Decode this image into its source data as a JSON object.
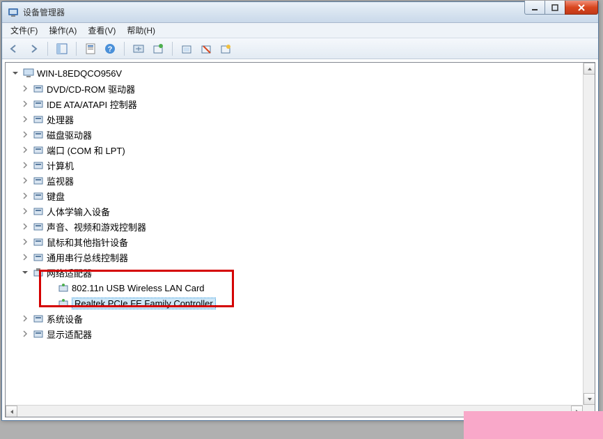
{
  "window": {
    "title": "设备管理器"
  },
  "menu": {
    "file": "文件(F)",
    "action": "操作(A)",
    "view": "查看(V)",
    "help": "帮助(H)"
  },
  "tree": {
    "root": "WIN-L8EDQCO956V",
    "items": [
      {
        "label": "DVD/CD-ROM 驱动器",
        "icon": "disc"
      },
      {
        "label": "IDE ATA/ATAPI 控制器",
        "icon": "ide"
      },
      {
        "label": "处理器",
        "icon": "cpu"
      },
      {
        "label": "磁盘驱动器",
        "icon": "disk"
      },
      {
        "label": "端口 (COM 和 LPT)",
        "icon": "port"
      },
      {
        "label": "计算机",
        "icon": "computer"
      },
      {
        "label": "监视器",
        "icon": "monitor"
      },
      {
        "label": "键盘",
        "icon": "keyboard"
      },
      {
        "label": "人体学输入设备",
        "icon": "hid"
      },
      {
        "label": "声音、视频和游戏控制器",
        "icon": "sound"
      },
      {
        "label": "鼠标和其他指针设备",
        "icon": "mouse"
      },
      {
        "label": "通用串行总线控制器",
        "icon": "usb"
      }
    ],
    "network": {
      "label": "网络适配器",
      "children": [
        "802.11n USB Wireless LAN Card",
        "Realtek PCIe FE Family Controller"
      ]
    },
    "after": [
      {
        "label": "系统设备",
        "icon": "system"
      },
      {
        "label": "显示适配器",
        "icon": "display"
      }
    ]
  }
}
